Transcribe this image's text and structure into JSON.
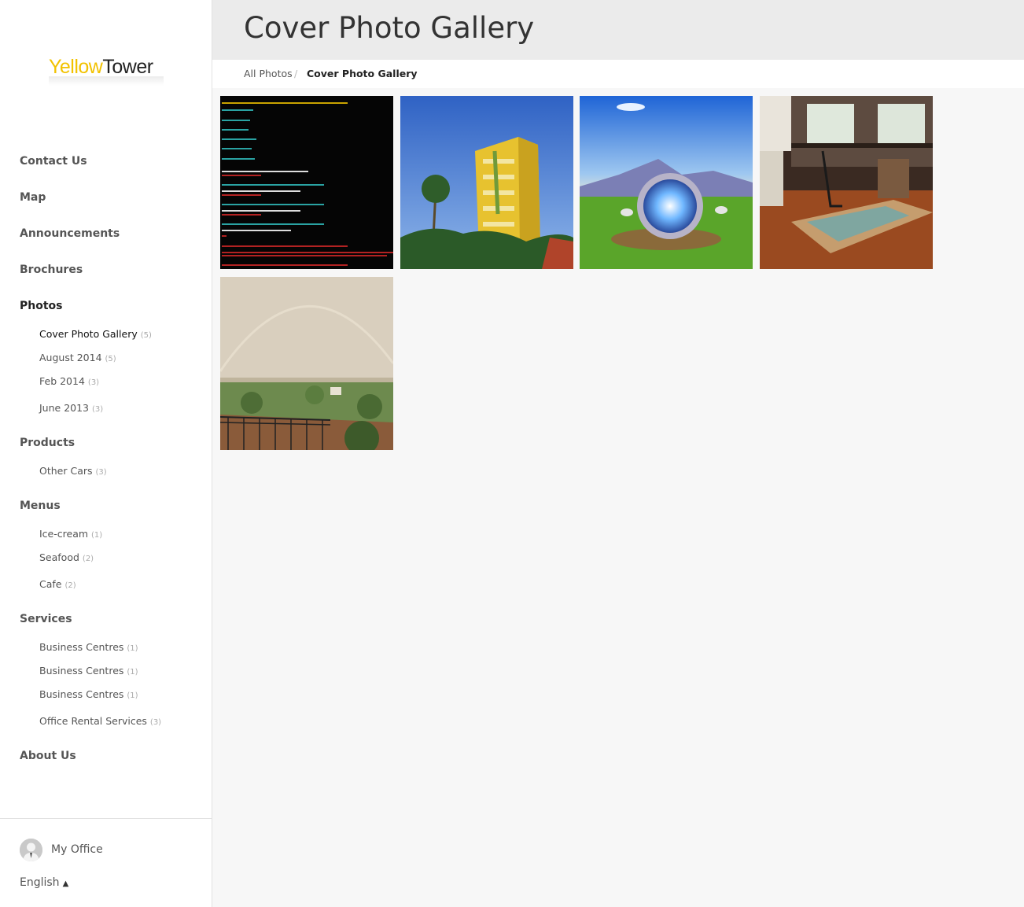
{
  "brand": {
    "logo_part1": "Yellow",
    "logo_part2": "Tower"
  },
  "sidebar": {
    "sections": [
      {
        "label": "Contact Us"
      },
      {
        "label": "Map"
      },
      {
        "label": "Announcements"
      },
      {
        "label": "Brochures"
      },
      {
        "label": "Photos",
        "items": [
          {
            "label": "Cover Photo Gallery",
            "count": "(5)"
          },
          {
            "label": "August 2014",
            "count": "(5)"
          },
          {
            "label": "Feb 2014",
            "count": "(3)"
          },
          {
            "label": "June 2013",
            "count": "(3)"
          }
        ]
      },
      {
        "label": "Products",
        "items": [
          {
            "label": "Other Cars",
            "count": "(3)"
          }
        ]
      },
      {
        "label": "Menus",
        "items": [
          {
            "label": "Ice-cream",
            "count": "(1)"
          },
          {
            "label": "Seafood",
            "count": "(2)"
          },
          {
            "label": "Cafe",
            "count": "(2)"
          }
        ]
      },
      {
        "label": "Services",
        "items": [
          {
            "label": "Business Centres",
            "count": "(1)"
          },
          {
            "label": "Business Centres",
            "count": "(1)"
          },
          {
            "label": "Business Centres",
            "count": "(1)"
          },
          {
            "label": "Office Rental Services",
            "count": "(3)"
          }
        ]
      },
      {
        "label": "About Us"
      }
    ],
    "footer": {
      "my_office": "My Office",
      "language": "English"
    }
  },
  "page": {
    "title": "Cover Photo Gallery",
    "breadcrumb": {
      "parent": "All Photos",
      "separator": "/",
      "current": "Cover Photo Gallery"
    }
  },
  "colors": {
    "accent_yellow": "#f2c200",
    "sidebar_bg": "#ffffff",
    "header_bg": "#ebebeb",
    "content_bg": "#f7f7f7"
  },
  "icons": {
    "avatar": "user-avatar-icon",
    "language_caret": "caret-up-icon"
  },
  "gallery": [
    {
      "name": "terminal-screenshot-photo"
    },
    {
      "name": "yellow-tower-building-photo"
    },
    {
      "name": "fantasy-portal-photo"
    },
    {
      "name": "loft-interior-photo"
    },
    {
      "name": "rainbow-landscape-photo"
    }
  ]
}
